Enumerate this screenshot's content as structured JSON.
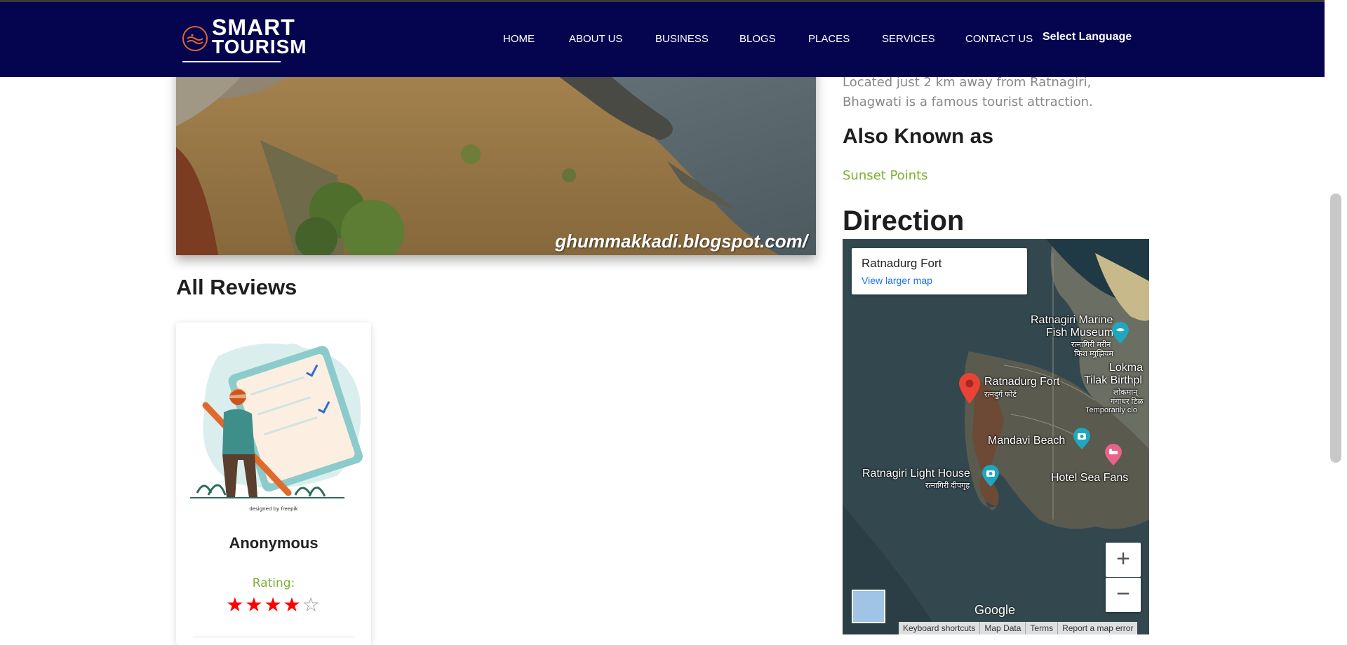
{
  "header": {
    "logo": {
      "line1": "SMART",
      "line2": "TOURISM"
    },
    "nav": [
      {
        "label": "HOME"
      },
      {
        "label": "ABOUT US"
      },
      {
        "label": "BUSINESS"
      },
      {
        "label": "BLOGS"
      },
      {
        "label": "PLACES"
      },
      {
        "label": "SERVICES"
      },
      {
        "label": "CONTACT US"
      }
    ],
    "language": "Select Language"
  },
  "hero": {
    "watermark": "ghummakkadi.blogspot.com/"
  },
  "reviews": {
    "title": "All Reviews",
    "cards": [
      {
        "credit": "designed by freepik",
        "name": "Anonymous",
        "rating_label": "Rating:",
        "rating": 4,
        "rating_max": 5
      }
    ]
  },
  "sidebar": {
    "description": "Located just 2 km away from Ratnagiri, Bhagwati is a famous tourist attraction.",
    "also_known_title": "Also Known as",
    "also_known_value": "Sunset Points",
    "direction_title": "Direction"
  },
  "map": {
    "place_title": "Ratnadurg Fort",
    "larger_map_link": "View larger map",
    "labels": {
      "museum": "Ratnagiri Marine",
      "museum2": "Fish Museum",
      "museum_mr1": "रत्नागिरी मरीन",
      "museum_mr2": "फिश म्युझियम",
      "lokmanya": "Lokma",
      "tilak": "Tilak Birthpl",
      "tilak_mr1": "लोकमान्",
      "tilak_mr2": "गंगाधर टिळ",
      "temp_closed": "Temporarily clo",
      "fort": "Ratnadurg Fort",
      "fort_mr": "रत्नदुर्ग फोर्ट",
      "beach": "Mandavi Beach",
      "lighthouse": "Ratnagiri Light House",
      "lighthouse_mr": "रत्नागिरी दीपगृह",
      "hotel": "Hotel Sea Fans"
    },
    "zoom_in": "+",
    "zoom_out": "−",
    "brand": "Google",
    "footer": [
      "Keyboard shortcuts",
      "Map Data",
      "Terms",
      "Report a map error"
    ],
    "colors": {
      "pin": "#ea4335",
      "camera_pin": "#1fa7c0",
      "hotel_pin": "#e8628a"
    }
  },
  "colors": {
    "header_bg": "#05054f",
    "accent_green": "#7ab030",
    "star_on": "#ff0000"
  }
}
